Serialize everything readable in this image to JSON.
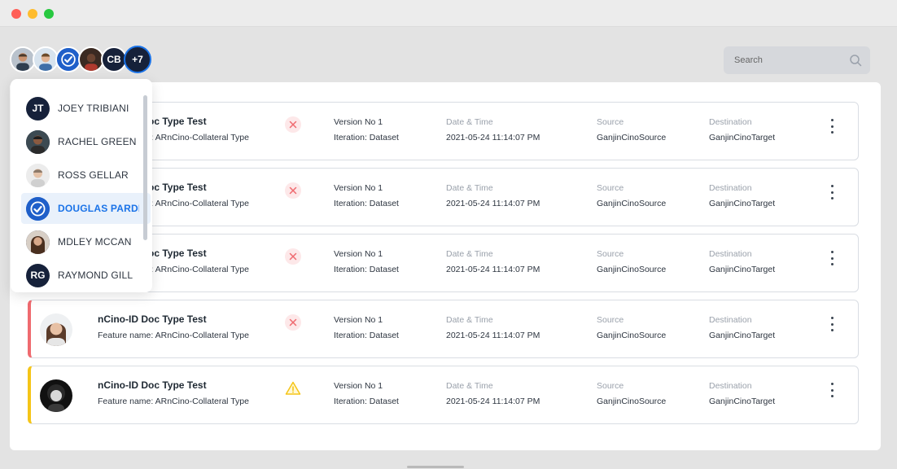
{
  "window": {
    "title": ""
  },
  "avatars": {
    "initials": "CB",
    "more_count": "+7"
  },
  "search": {
    "placeholder": "Search"
  },
  "labels": {
    "version": "Version No 1",
    "iteration": "Iteration: Dataset",
    "datetime_label": "Date & Time",
    "source_label": "Source",
    "destination_label": "Destination"
  },
  "cards": [
    {
      "title": "nCino-ID Doc Type Test",
      "feature": "Feature name: ARnCino-Collateral Type",
      "status": "error",
      "datetime": "2021-05-24 11:14:07 PM",
      "source": "GanjinCinoSource",
      "destination": "GanjinCinoTarget"
    },
    {
      "title": "nCino-ID Doc Type Test",
      "feature": "Feature name: ARnCino-Collateral Type",
      "status": "error",
      "datetime": "2021-05-24 11:14:07 PM",
      "source": "GanjinCinoSource",
      "destination": "GanjinCinoTarget"
    },
    {
      "title": "nCino-ID Doc Type Test",
      "feature": "Feature name: ARnCino-Collateral Type",
      "status": "error",
      "datetime": "2021-05-24 11:14:07 PM",
      "source": "GanjinCinoSource",
      "destination": "GanjinCinoTarget"
    },
    {
      "title": "nCino-ID Doc Type Test",
      "feature": "Feature name: ARnCino-Collateral Type",
      "status": "error",
      "datetime": "2021-05-24 11:14:07 PM",
      "source": "GanjinCinoSource",
      "destination": "GanjinCinoTarget"
    },
    {
      "title": "nCino-ID Doc Type Test",
      "feature": "Feature name: ARnCino-Collateral Type",
      "status": "warning",
      "datetime": "2021-05-24 11:14:07 PM",
      "source": "GanjinCinoSource",
      "destination": "GanjinCinoTarget"
    }
  ],
  "user_dropdown": {
    "users": [
      {
        "name": "JOEY TRIBIANI",
        "initials": "JT",
        "type": "initials"
      },
      {
        "name": "RACHEL GREEN",
        "type": "photo"
      },
      {
        "name": "ROSS GELLAR",
        "type": "photo"
      },
      {
        "name": "DOUGLAS PARDE",
        "type": "check",
        "selected": true
      },
      {
        "name": "MDLEY MCCAN",
        "type": "photo"
      },
      {
        "name": "RAYMOND GILL",
        "initials": "RG",
        "type": "initials"
      }
    ]
  },
  "colors": {
    "accent": "#1a73e8",
    "error": "#ef6a6f",
    "warning": "#f5c518",
    "avatar_dark": "#16213a"
  }
}
